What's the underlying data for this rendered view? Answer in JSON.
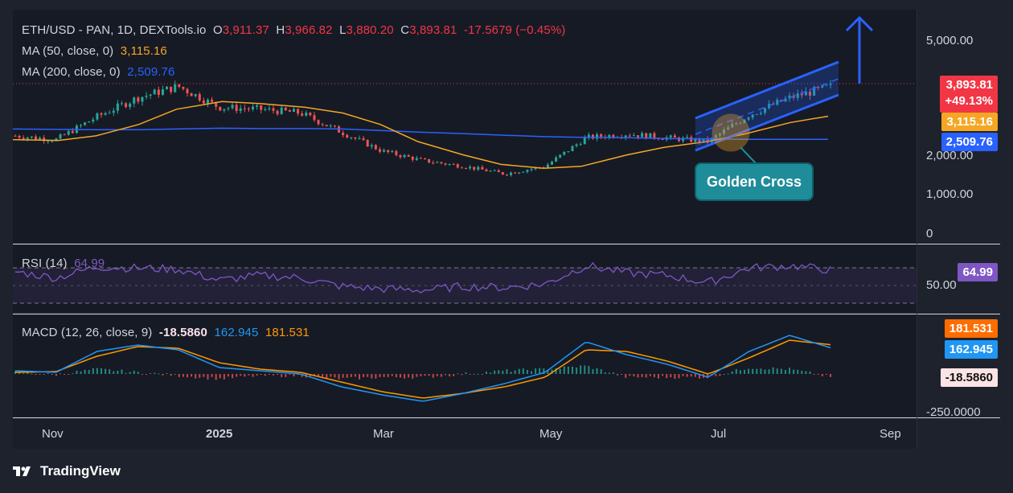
{
  "header": {
    "symbol": "ETH/USD - PAN, 1D, DEXTools.io",
    "o_label": "O",
    "o": "3,911.37",
    "h_label": "H",
    "h": "3,966.82",
    "l_label": "L",
    "l": "3,880.20",
    "c_label": "C",
    "c": "3,893.81",
    "change": "-17.5679 (−0.45%)",
    "ma50_label": "MA (50, close, 0)",
    "ma50_value": "3,115.16",
    "ma200_label": "MA (200, close, 0)",
    "ma200_value": "2,509.76"
  },
  "rsi": {
    "label": "RSI (14)",
    "value": "64.99"
  },
  "macd": {
    "label": "MACD (12, 26, close, 9)",
    "hist": "-18.5860",
    "macd": "162.945",
    "signal": "181.531"
  },
  "price_tags": {
    "last": "3,893.81",
    "pct": "+49.13%",
    "ma50": "3,115.16",
    "ma200": "2,509.76",
    "rsi": "64.99",
    "macd_signal": "181.531",
    "macd_line": "162.945",
    "macd_hist": "-18.5860"
  },
  "axis": {
    "price_ticks": [
      "5,000.00",
      "2,000.00",
      "1,000.00",
      "0"
    ],
    "rsi_ticks": [
      "50.00"
    ],
    "macd_ticks": [
      "-250.0000"
    ],
    "x_ticks": [
      "Nov",
      "2025",
      "Mar",
      "May",
      "Jul",
      "Sep"
    ]
  },
  "annotation": {
    "golden_cross": "Golden Cross"
  },
  "brand": "TradingView",
  "colors": {
    "background": "#1e222d",
    "up": "#26a69a",
    "down": "#ef5350",
    "ma50": "#f5a623",
    "ma200": "#2962ff",
    "rsi": "#7e57c2",
    "macd": "#2196f3",
    "signal": "#ff9800",
    "channel": "#2962ff"
  },
  "chart_data": {
    "type": "candlestick",
    "x_range": [
      "2024-10-15",
      "2025-08-15"
    ],
    "price_ylim": [
      0,
      5500
    ],
    "price": {
      "x": [
        "2024-10-15",
        "2024-11-01",
        "2024-11-15",
        "2024-12-01",
        "2024-12-15",
        "2025-01-01",
        "2025-01-15",
        "2025-02-01",
        "2025-02-15",
        "2025-03-01",
        "2025-03-15",
        "2025-04-01",
        "2025-04-15",
        "2025-05-01",
        "2025-05-15",
        "2025-06-01",
        "2025-06-15",
        "2025-07-01",
        "2025-07-15",
        "2025-08-01",
        "2025-08-15"
      ],
      "close": [
        2600,
        2500,
        3100,
        3600,
        3900,
        3350,
        3300,
        3200,
        2700,
        2200,
        1950,
        1800,
        1600,
        1800,
        2550,
        2650,
        2550,
        2450,
        3150,
        3600,
        3894
      ]
    },
    "ma50": [
      2500,
      2480,
      2600,
      2900,
      3300,
      3500,
      3450,
      3350,
      3200,
      2900,
      2450,
      2100,
      1850,
      1750,
      1800,
      2100,
      2300,
      2450,
      2650,
      2950,
      3115
    ],
    "ma200": [
      2780,
      2770,
      2760,
      2760,
      2780,
      2800,
      2790,
      2790,
      2780,
      2740,
      2700,
      2660,
      2620,
      2580,
      2560,
      2550,
      2530,
      2520,
      2510,
      2510,
      2510
    ],
    "rsi_ylim": [
      0,
      100
    ],
    "rsi": [
      62,
      52,
      70,
      68,
      66,
      48,
      56,
      52,
      38,
      34,
      32,
      38,
      36,
      42,
      72,
      60,
      56,
      44,
      68,
      72,
      65
    ],
    "macd_ylim": [
      -300,
      300
    ],
    "macd_line": [
      20,
      10,
      140,
      180,
      150,
      40,
      20,
      0,
      -80,
      -130,
      -170,
      -120,
      -60,
      10,
      200,
      120,
      60,
      -20,
      140,
      240,
      163
    ],
    "macd_signal": [
      10,
      15,
      110,
      170,
      160,
      70,
      30,
      10,
      -50,
      -110,
      -150,
      -120,
      -80,
      -20,
      150,
      140,
      80,
      0,
      100,
      210,
      182
    ],
    "macd_hist": [
      10,
      -5,
      30,
      10,
      -10,
      -30,
      -10,
      -10,
      -30,
      -20,
      -20,
      0,
      20,
      30,
      50,
      -20,
      -20,
      -20,
      40,
      30,
      -18.586
    ]
  }
}
